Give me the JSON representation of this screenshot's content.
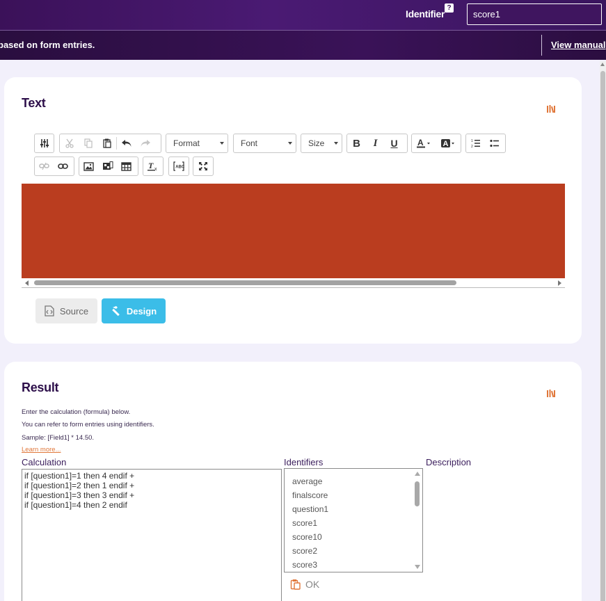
{
  "header": {
    "identifier_label": "Identifier",
    "help_badge": "?",
    "identifier_value": "score1"
  },
  "subheader": {
    "text": "based on form entries.",
    "manual_link": "View manual"
  },
  "text_section": {
    "title": "Text",
    "toolbar": {
      "format_label": "Format",
      "font_label": "Font",
      "size_label": "Size"
    },
    "editor_bg_color": "#ba3d1f",
    "source_label": "Source",
    "design_label": "Design"
  },
  "result_section": {
    "title": "Result",
    "info_lines": [
      "Enter the calculation (formula) below.",
      "You can refer to form entries using identifiers.",
      "Sample: [Field1] * 14.50."
    ],
    "learn_more": "Learn more...",
    "calculation_label": "Calculation",
    "identifiers_label": "Identifiers",
    "description_label": "Description",
    "calculation_lines": [
      "if [question1]=1 then 4 endif +",
      "if [question1]=2 then 1 endif +",
      "if [question1]=3 then 3 endif +",
      "if [question1]=4 then 2 endif"
    ],
    "identifiers": [
      "average",
      "finalscore",
      "question1",
      "score1",
      "score10",
      "score2",
      "score3"
    ],
    "ok_label": "OK"
  },
  "colors": {
    "accent": "#3bbde8",
    "brand_purple": "#3b1159",
    "icon_orange": "#e0773a"
  }
}
